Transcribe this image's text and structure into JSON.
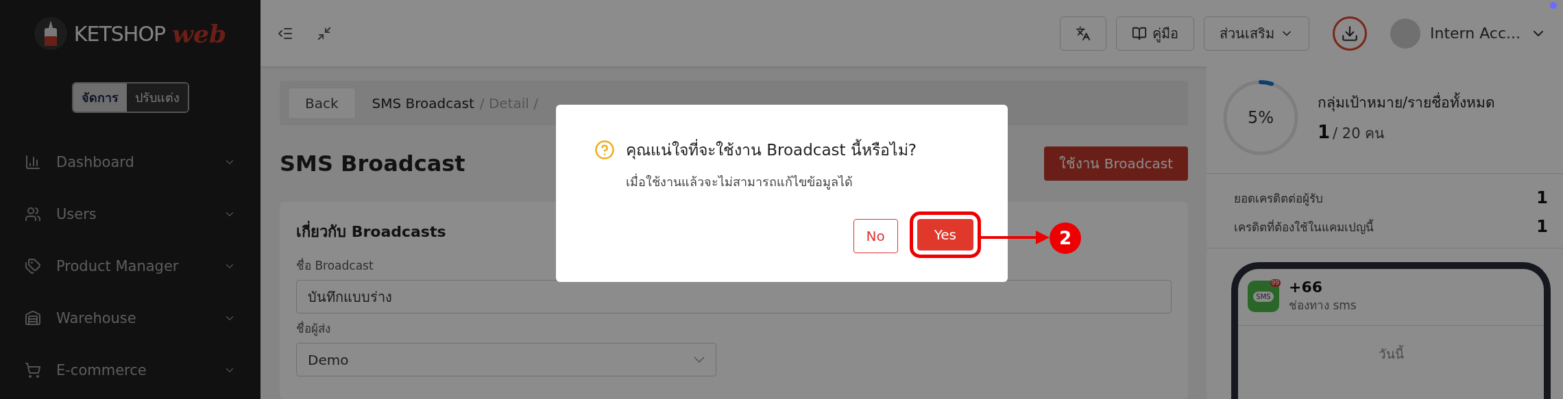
{
  "sidebar": {
    "logo": {
      "brand": "KETSHOP",
      "suffix": "web"
    },
    "mode_tabs": [
      {
        "label": "จัดการ",
        "selected": true
      },
      {
        "label": "ปรับแต่ง",
        "selected": false
      }
    ],
    "items": [
      {
        "label": "Dashboard",
        "kind": "chart"
      },
      {
        "label": "Users",
        "kind": "users"
      },
      {
        "label": "Product Manager",
        "kind": "tags"
      },
      {
        "label": "Warehouse",
        "kind": "warehouse"
      },
      {
        "label": "E-commerce",
        "kind": "cart"
      }
    ]
  },
  "topbar": {
    "guide": "คู่มือ",
    "addons": "ส่วนเสริม",
    "user": "Intern Acc..."
  },
  "main": {
    "back": "Back",
    "breadcrumb": [
      "SMS Broadcast",
      "/ Detail /"
    ],
    "title": "SMS Broadcast",
    "action": "ใช้งาน Broadcast",
    "card": {
      "heading": "เกี่ยวกับ Broadcasts",
      "fields": [
        {
          "label": "ชื่อ Broadcast",
          "value": "บันทึกแบบร่าง",
          "kind": "text"
        },
        {
          "label": "ชื่อผู้ส่ง",
          "value": "Demo",
          "kind": "select"
        }
      ]
    }
  },
  "summary": {
    "progress": {
      "level": 0.05,
      "reading": "5%"
    },
    "title": "กลุ่มเป้าหมาย/รายชื่อทั้งหมด",
    "count": "1",
    "total": "/ 20 คน",
    "stats": [
      {
        "label": "ยอดเครดิตต่อผู้รับ",
        "value": "1"
      },
      {
        "label": "เครดิตที่ต้องใช้ในแคมเปญนี้",
        "value": "1"
      }
    ],
    "preview": {
      "app_label": "SMS",
      "badge": "99",
      "sender": "+66",
      "channel": "ช่องทาง sms",
      "date": "วันนี้"
    }
  },
  "modal": {
    "title": "คุณแน่ใจที่จะใช้งาน Broadcast นี้หรือไม่?",
    "message": "เมื่อใช้งานแล้วจะไม่สามารถแก้ไขข้อมูลได้",
    "buttons": [
      {
        "label": "No",
        "kind": "secondary"
      },
      {
        "label": "Yes",
        "kind": "primary"
      }
    ],
    "step": "2"
  }
}
